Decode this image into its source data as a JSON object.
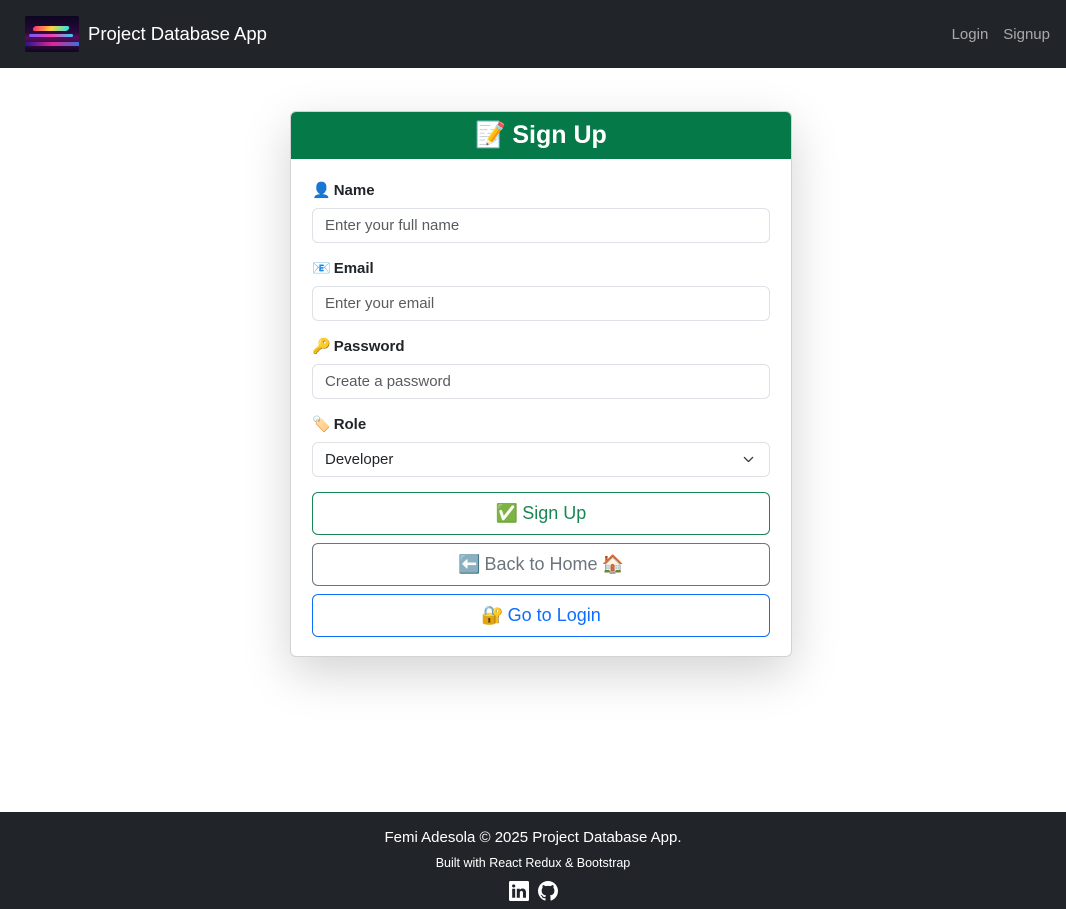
{
  "navbar": {
    "brand_title": "Project Database App",
    "links": [
      {
        "label": "Login"
      },
      {
        "label": "Signup"
      }
    ]
  },
  "card": {
    "header_emoji": "📝",
    "title": "Sign Up",
    "fields": {
      "name": {
        "emoji": "👤",
        "label": "Name",
        "placeholder": "Enter your full name",
        "value": ""
      },
      "email": {
        "emoji": "📧",
        "label": "Email",
        "placeholder": "Enter your email",
        "value": ""
      },
      "password": {
        "emoji": "🔑",
        "label": "Password",
        "placeholder": "Create a password",
        "value": ""
      },
      "role": {
        "emoji": "🏷️",
        "label": "Role",
        "selected": "Developer"
      }
    },
    "buttons": {
      "signup": {
        "emoji": "✅",
        "label": "Sign Up"
      },
      "back_home": {
        "emoji_before": "⬅️",
        "label": "Back to Home",
        "emoji_after": "🏠"
      },
      "go_login": {
        "emoji": "🔐",
        "label": "Go to Login"
      }
    }
  },
  "footer": {
    "copyright": "Femi Adesola © 2025 Project Database App.",
    "built_with": "Built with React Redux & Bootstrap",
    "icons": [
      "linkedin-icon",
      "github-icon"
    ]
  },
  "colors": {
    "navbar_bg": "#212529",
    "header_green": "#057a48",
    "success": "#198754",
    "secondary": "#6c757d",
    "primary": "#0d6efd"
  }
}
